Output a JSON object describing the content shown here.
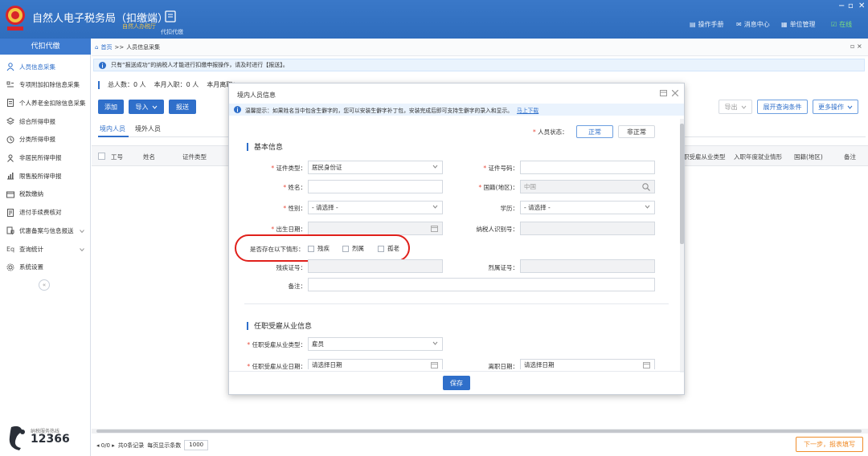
{
  "header": {
    "title": "自然人电子税务局（扣缴端）",
    "subtitle": "自然人办税厅",
    "nav": "代扣代缴",
    "links": [
      "操作手册",
      "消息中心",
      "单位管理"
    ],
    "status": "在线",
    "window_controls": [
      "−",
      "▫",
      "✕"
    ]
  },
  "sidebar": {
    "title": "代扣代缴",
    "items": [
      {
        "label": "人员信息采集",
        "icon": "person-icon"
      },
      {
        "label": "专项附加扣除信息采集",
        "icon": "list-icon"
      },
      {
        "label": "个人养老金扣除信息采集",
        "icon": "document-icon"
      },
      {
        "label": "综合所得申报",
        "icon": "layers-icon"
      },
      {
        "label": "分类所得申报",
        "icon": "clock-icon"
      },
      {
        "label": "非居民所得申报",
        "icon": "person-outline-icon"
      },
      {
        "label": "限售股所得申报",
        "icon": "chart-icon"
      },
      {
        "label": "税款缴纳",
        "icon": "wallet-icon"
      },
      {
        "label": "退付手续费核对",
        "icon": "receipt-icon"
      },
      {
        "label": "优惠备案与信息报送",
        "icon": "shield-doc-icon"
      },
      {
        "label": "查询统计",
        "icon": "search-doc-icon"
      },
      {
        "label": "系统设置",
        "icon": "gear-icon"
      }
    ],
    "hotline_label": "纳税服务热线",
    "hotline": "12366"
  },
  "main": {
    "breadcrumb": {
      "home": "首页",
      "sep": ">>",
      "current": "人员信息采集"
    },
    "close_label": "▫ ×",
    "notice": "只有“报送成功”的纳税人才能进行扣缴申报操作，请及时进行【报送】。",
    "stats": {
      "total": "总人数：0 人",
      "joined": "本月入职：0 人",
      "left": "本月离职："
    },
    "toolbar": {
      "add": "添加",
      "import": "导入",
      "submit": "报送",
      "export": "导出",
      "expand": "展开查询条件",
      "more": "更多操作"
    },
    "tabs": [
      "境内人员",
      "境外人员"
    ],
    "columns_left": [
      "工号",
      "姓名",
      "证件类型"
    ],
    "columns_right": [
      "职受雇从业类型",
      "入职年度就业情形",
      "国籍(地区)",
      "备注"
    ],
    "pager": {
      "nav": "◂ 0/0 ▸",
      "records": "共0条记录",
      "page_size_label": "每页显示条数",
      "page_size": "1000"
    },
    "next_button": "下一步，报表填写"
  },
  "modal": {
    "title": "境内人员信息",
    "tip": "温馨提示：如果姓名当中包含生僻字的，您可以安装生僻字补丁包，安装完成后即可支持生僻字的录入和显示。",
    "tip_link": "马上下载",
    "status_label": "人员状态：",
    "status_options": [
      "正常",
      "非正常"
    ],
    "section_basic": "基本信息",
    "section_employment": "任职受雇从业信息",
    "fields": {
      "id_type": {
        "label": "证件类型：",
        "value": "居民身份证"
      },
      "id_number": {
        "label": "证件号码："
      },
      "name": {
        "label": "姓名："
      },
      "nationality": {
        "label": "国籍(地区)：",
        "value": "中国"
      },
      "gender": {
        "label": "性别：",
        "value": "- 请选择 -"
      },
      "education": {
        "label": "学历：",
        "value": "- 请选择 -"
      },
      "birth_date": {
        "label": "出生日期："
      },
      "tin": {
        "label": "纳税人识别号："
      },
      "situations": {
        "label": "是否存在以下情形：",
        "options": [
          "残疾",
          "烈属",
          "孤老"
        ]
      },
      "disability_no": {
        "label": "残疾证号："
      },
      "martyr_no": {
        "label": "烈属证号："
      },
      "remark": {
        "label": "备注："
      },
      "employment_type": {
        "label": "任职受雇从业类型：",
        "value": "雇员"
      },
      "employment_date": {
        "label": "任职受雇从业日期：",
        "placeholder": "请选择日期"
      },
      "leave_date": {
        "label": "离职日期：",
        "placeholder": "请选择日期"
      }
    },
    "save": "保存"
  }
}
